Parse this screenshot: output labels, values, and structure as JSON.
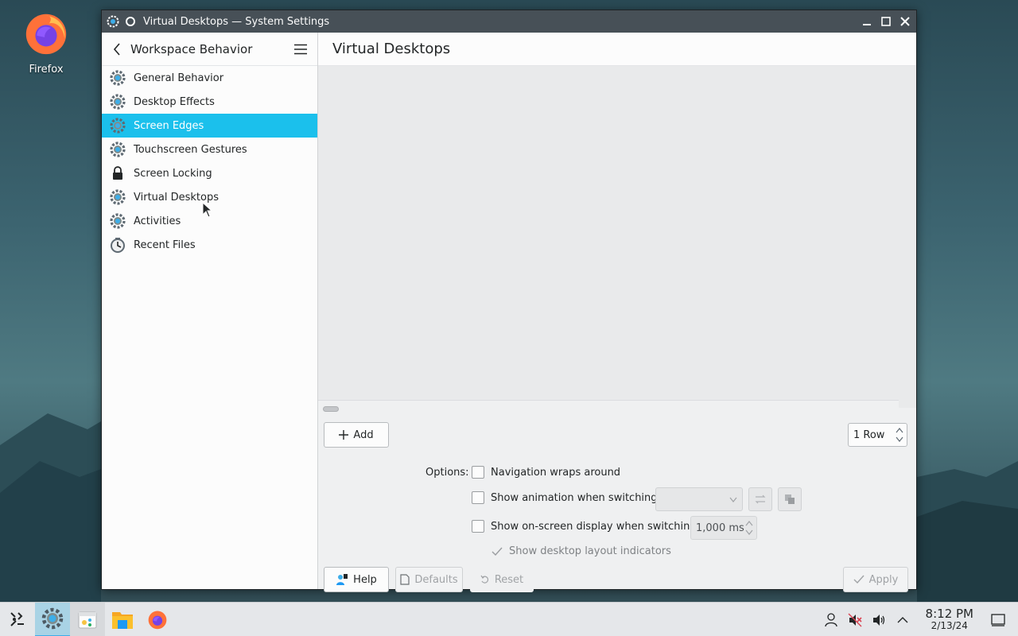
{
  "desktop": {
    "icons": [
      {
        "label": "Firefox",
        "icon": "firefox-icon"
      }
    ]
  },
  "window": {
    "title": "Virtual Desktops — System Settings",
    "controls": [
      "minimize",
      "maximize",
      "close"
    ]
  },
  "sidebar": {
    "back_icon": "arrow-left-icon",
    "title": "Workspace Behavior",
    "menu_icon": "hamburger-icon",
    "items": [
      {
        "label": "General Behavior",
        "icon": "gear-icon"
      },
      {
        "label": "Desktop Effects",
        "icon": "gear-icon"
      },
      {
        "label": "Screen Edges",
        "icon": "gear-icon",
        "active": true
      },
      {
        "label": "Touchscreen Gestures",
        "icon": "gear-icon"
      },
      {
        "label": "Screen Locking",
        "icon": "lock-icon"
      },
      {
        "label": "Virtual Desktops",
        "icon": "gear-icon"
      },
      {
        "label": "Activities",
        "icon": "gear-icon"
      },
      {
        "label": "Recent Files",
        "icon": "clock-icon"
      }
    ]
  },
  "main": {
    "title": "Virtual Desktops",
    "add_label": "Add",
    "rows_value": "1 Row",
    "options_label": "Options:",
    "options": [
      {
        "label": "Navigation wraps around",
        "checked": false
      },
      {
        "label": "Show animation when switching:",
        "checked": false
      },
      {
        "label": "Show on-screen display when switching:",
        "checked": false
      }
    ],
    "osd_duration": "1,000 ms",
    "layout_indicators_label": "Show desktop layout indicators",
    "footer": {
      "help": "Help",
      "defaults": "Defaults",
      "reset": "Reset",
      "apply": "Apply"
    }
  },
  "taskbar": {
    "apps": [
      "application-launcher-icon",
      "system-settings-icon",
      "calendar-icon",
      "file-manager-icon",
      "firefox-icon"
    ],
    "tray": [
      "user-icon",
      "microphone-muted-icon",
      "volume-icon",
      "chevron-up-icon"
    ],
    "time": "8:12 PM",
    "date": "2/13/24",
    "show_desktop_icon": "show-desktop-icon"
  },
  "colors": {
    "accent": "#1bc0ec",
    "titlebar": "#475057",
    "window_bg": "#eff0f1"
  }
}
